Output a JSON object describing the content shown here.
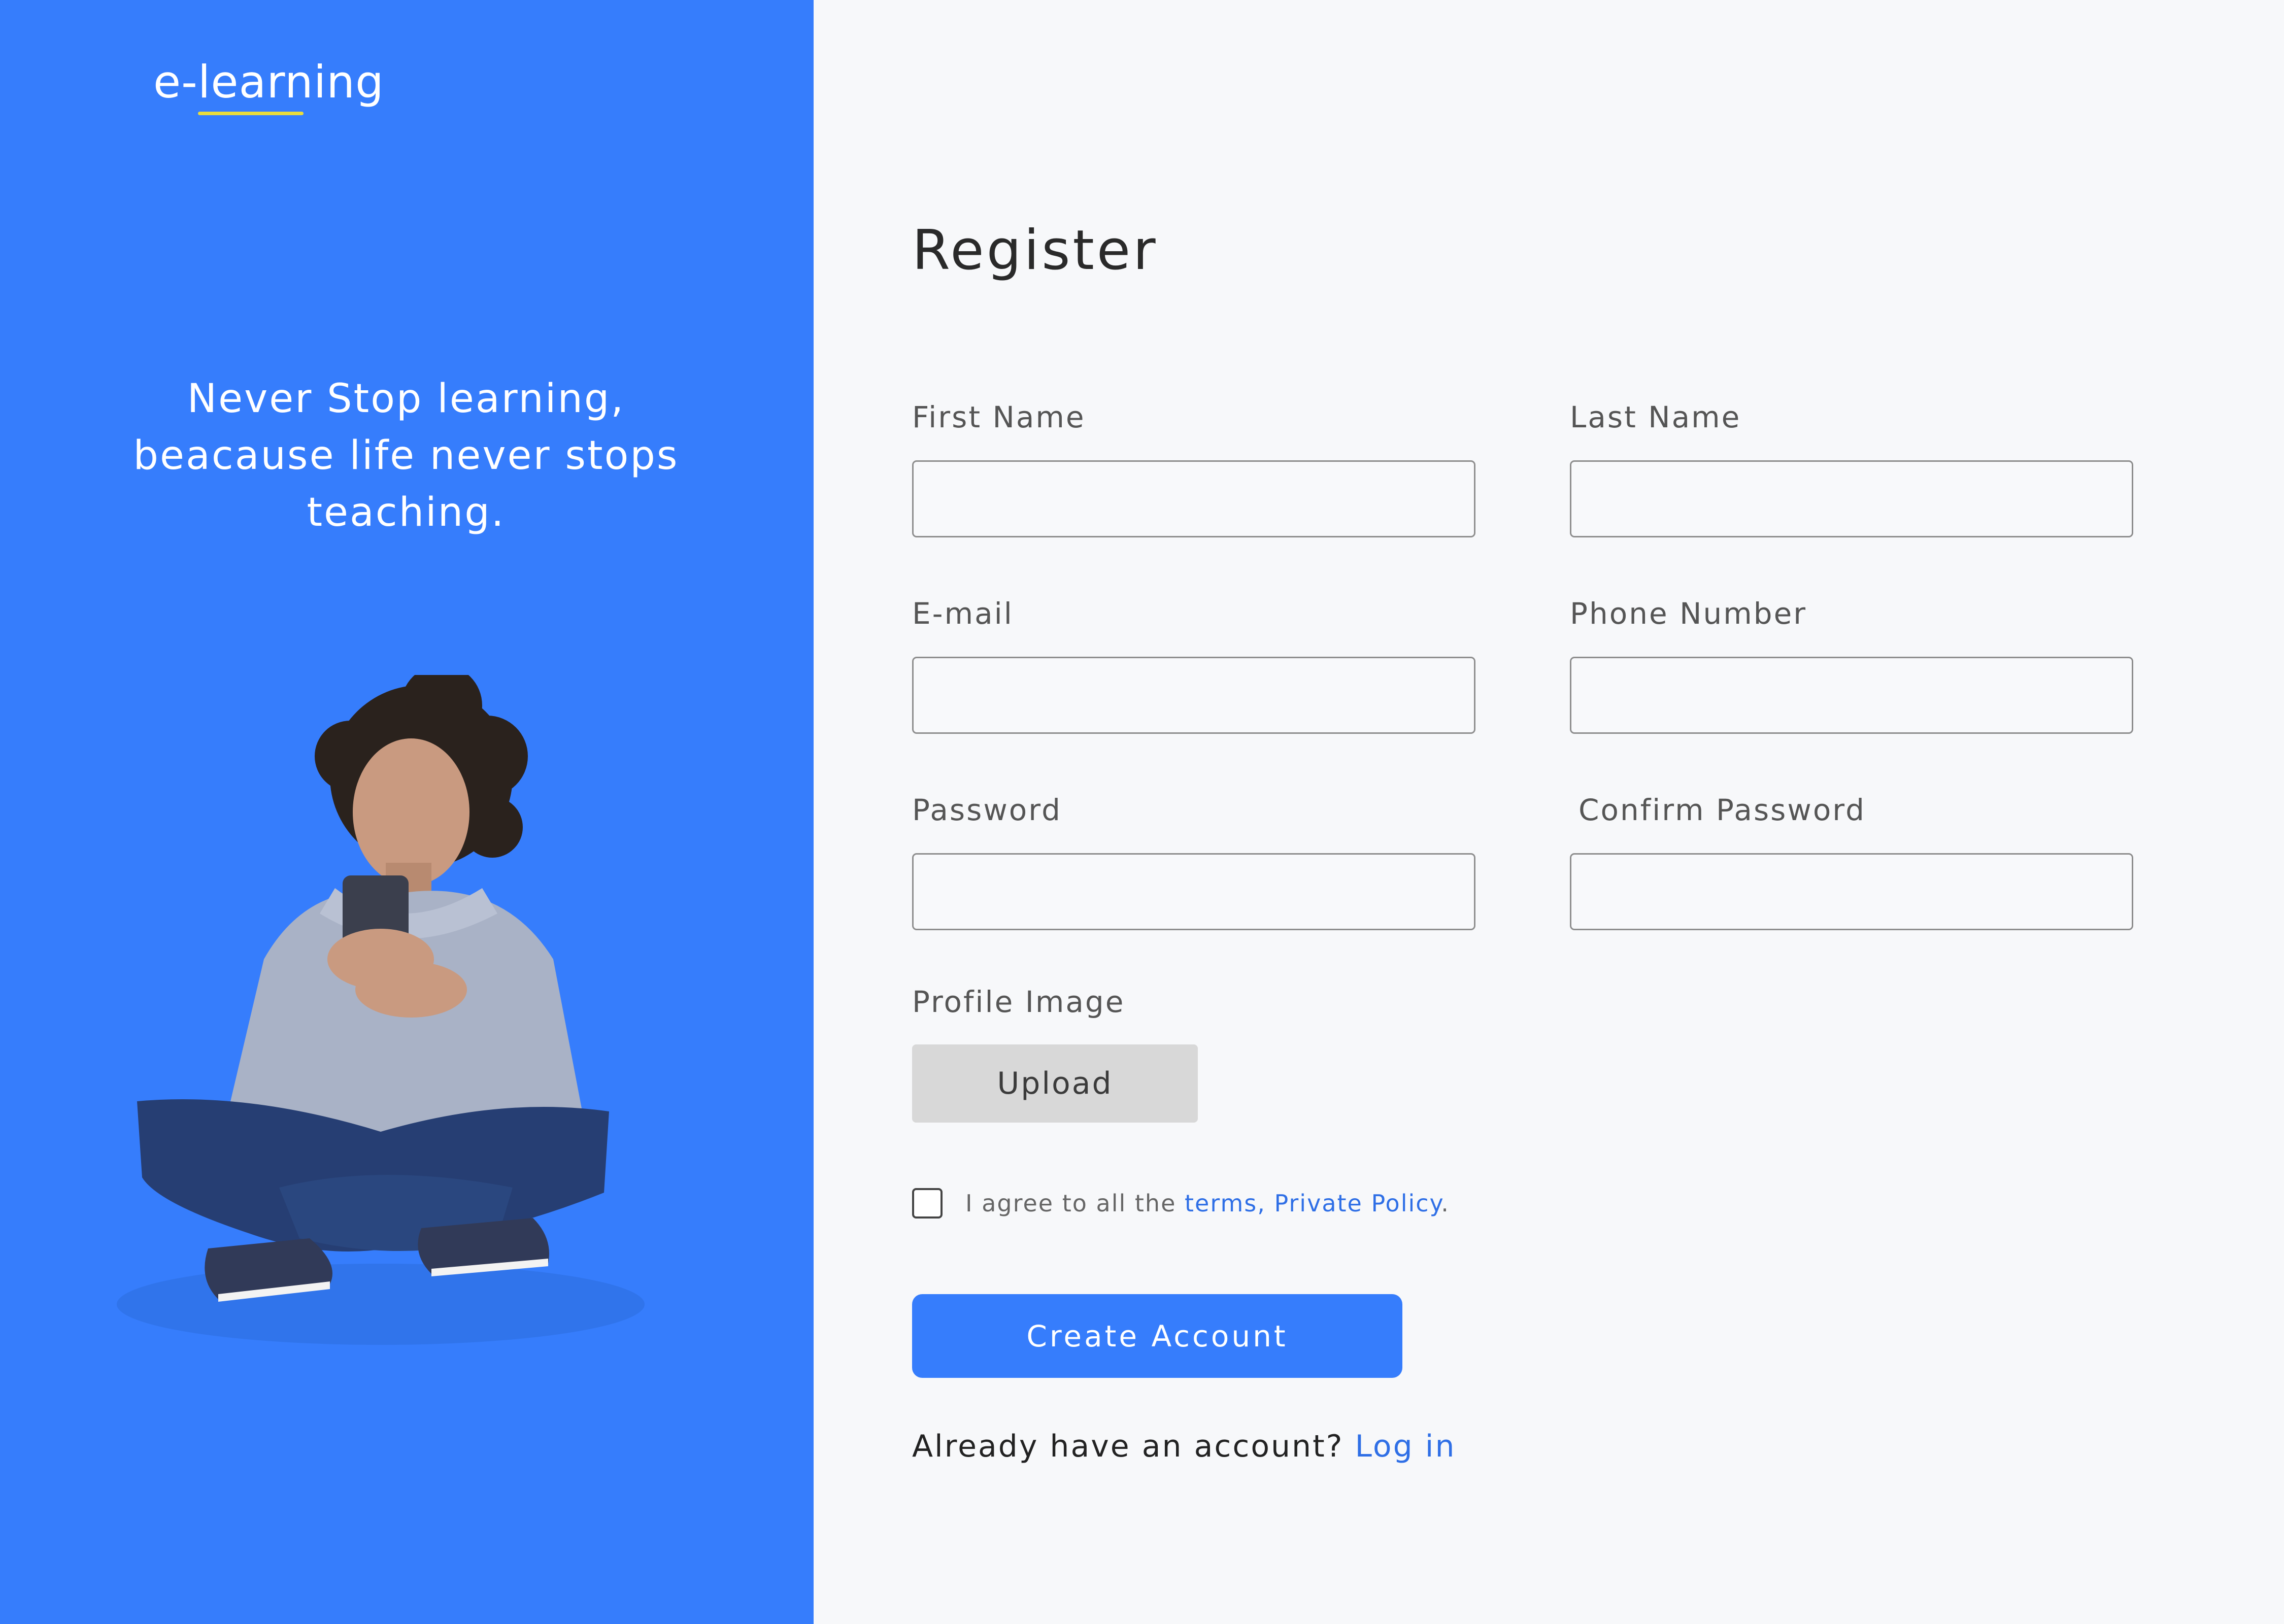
{
  "brand": {
    "logo_text": "e-learning",
    "tagline_lines": [
      "Never Stop learning,",
      "beacause life never stops",
      "teaching."
    ]
  },
  "colors": {
    "primary": "#367dfc",
    "link": "#2f6fe6",
    "page_bg": "#f7f8fa",
    "logo_underline": "#e9dc3c"
  },
  "form": {
    "title": "Register",
    "first_name_label": "First Name",
    "first_name_value": "",
    "last_name_label": "Last Name",
    "last_name_value": "",
    "email_label": "E-mail",
    "email_value": "",
    "phone_label": "Phone Number",
    "phone_value": "",
    "password_label": "Password",
    "password_value": "",
    "confirm_password_label": "Confirm Password",
    "confirm_password_value": "",
    "profile_image_label": "Profile Image",
    "upload_label": "Upload",
    "agree_prefix": "I agree to all the",
    "terms_link": "terms",
    "separator": ",",
    "privacy_link": "Private Policy",
    "agree_suffix": ".",
    "create_account_label": "Create Account",
    "already_text": "Already have an account?",
    "login_link": "Log in"
  }
}
